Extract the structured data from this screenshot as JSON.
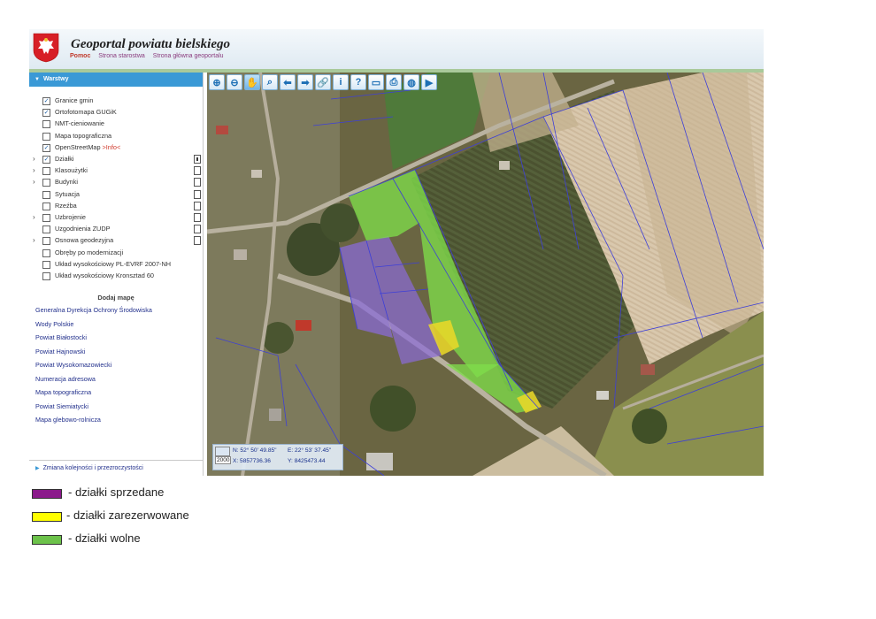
{
  "header": {
    "title": "Geoportal powiatu bielskiego",
    "links": [
      "Pomoc",
      "Strona starostwa",
      "Strona główna geoportalu"
    ]
  },
  "sidebar": {
    "layers_title": "Warstwy",
    "layers": [
      {
        "label": "Granice gmin",
        "checked": true,
        "expandable": false,
        "doc": false
      },
      {
        "label": "Ortofotomapa GUGiK",
        "checked": true,
        "expandable": false,
        "doc": false
      },
      {
        "label": "NMT-cieniowanie",
        "checked": false,
        "expandable": false,
        "doc": false
      },
      {
        "label": "Mapa topograficzna",
        "checked": false,
        "expandable": false,
        "doc": false
      },
      {
        "label": "OpenStreetMap",
        "info_text": ">Info<",
        "checked": true,
        "expandable": false,
        "doc": false
      },
      {
        "label": "Działki",
        "checked": true,
        "expandable": true,
        "doc": true,
        "doc_active": true
      },
      {
        "label": "Klasoużytki",
        "checked": false,
        "expandable": true,
        "doc": true
      },
      {
        "label": "Budynki",
        "checked": false,
        "expandable": true,
        "doc": true
      },
      {
        "label": "Sytuacja",
        "checked": false,
        "expandable": false,
        "doc": true
      },
      {
        "label": "Rzeźba",
        "checked": false,
        "expandable": false,
        "doc": true
      },
      {
        "label": "Uzbrojenie",
        "checked": false,
        "expandable": true,
        "doc": true
      },
      {
        "label": "Uzgodnienia ZUDP",
        "checked": false,
        "expandable": false,
        "doc": true
      },
      {
        "label": "Osnowa geodezyjna",
        "checked": false,
        "expandable": true,
        "doc": true
      },
      {
        "label": "Obręby po modernizacji",
        "checked": false,
        "expandable": false,
        "doc": false
      },
      {
        "label": "Układ wysokościowy PL-EVRF 2007-NH",
        "checked": false,
        "expandable": false,
        "doc": false
      },
      {
        "label": "Układ wysokościowy Kronsztad 60",
        "checked": false,
        "expandable": false,
        "doc": false
      }
    ],
    "add_map_title": "Dodaj mapę",
    "add_map_links": [
      "Generalna Dyrekcja Ochrony Środowiska",
      "Wody Polskie",
      "Powiat Białostocki",
      "Powiat Hajnowski",
      "Powiat Wysokomazowiecki",
      "Numeracja adresowa",
      "Mapa topograficzna",
      "Powiat Siemiatycki",
      "Mapa glebowo-rolnicza"
    ],
    "footer": "Zmiana kolejności i przezroczystości"
  },
  "toolbar": {
    "tools": [
      {
        "name": "zoom-in-icon",
        "glyph": "⊕"
      },
      {
        "name": "zoom-out-icon",
        "glyph": "⊖"
      },
      {
        "name": "pan-hand-icon",
        "glyph": "✋",
        "active": true
      },
      {
        "name": "zoom-extent-icon",
        "glyph": "⌕"
      },
      {
        "name": "back-arrow-icon",
        "glyph": "⬅"
      },
      {
        "name": "forward-arrow-icon",
        "glyph": "➡"
      },
      {
        "name": "link-icon",
        "glyph": "🔗"
      },
      {
        "name": "info-icon",
        "glyph": "i"
      },
      {
        "name": "query-icon",
        "glyph": "?"
      },
      {
        "name": "measure-icon",
        "glyph": "▭"
      },
      {
        "name": "print-icon",
        "glyph": "⎙"
      },
      {
        "name": "globe-icon",
        "glyph": "◍"
      },
      {
        "name": "video-icon",
        "glyph": "▶"
      }
    ]
  },
  "coords": {
    "n": "N:  52° 50' 49.85\"",
    "e": "E:  22° 53' 37.45\"",
    "x": "X:  5857736.36",
    "y": "Y:  8425473.44",
    "epsg": "2000"
  },
  "legend": [
    {
      "label": "- działki sprzedane",
      "color": "#8b1a8b"
    },
    {
      "label": "- działki zarezerwowane",
      "color": "#ffff00"
    },
    {
      "label": "- działki wolne",
      "color": "#6cc24a"
    }
  ]
}
